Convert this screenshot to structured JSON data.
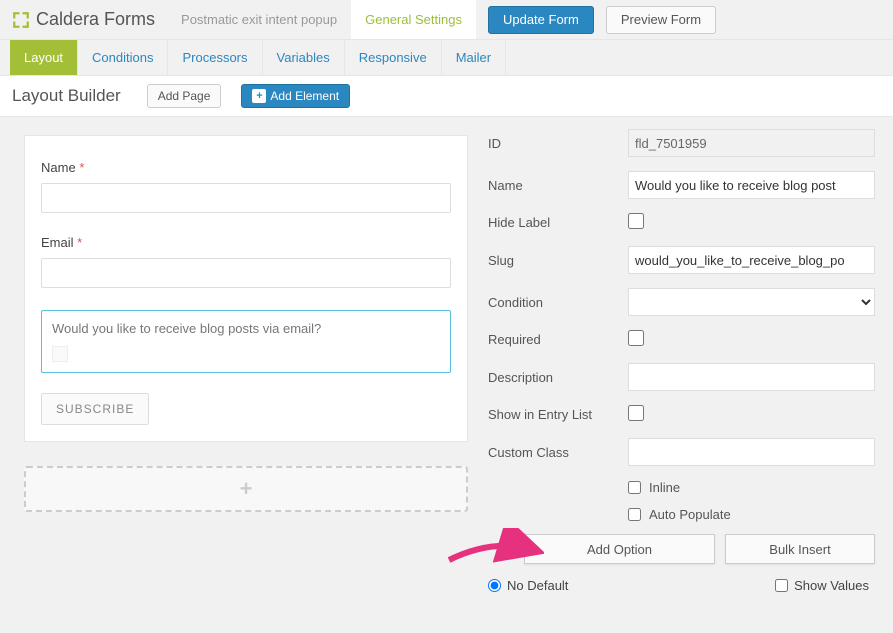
{
  "brand": {
    "title": "Caldera Forms"
  },
  "top": {
    "tab_inactive": "Postmatic exit intent popup",
    "tab_active": "General Settings",
    "update_btn": "Update Form",
    "preview_btn": "Preview Form"
  },
  "subtabs": [
    "Layout",
    "Conditions",
    "Processors",
    "Variables",
    "Responsive",
    "Mailer"
  ],
  "builder": {
    "title": "Layout Builder",
    "add_page": "Add Page",
    "add_element": "Add Element"
  },
  "preview": {
    "name_label": "Name",
    "email_label": "Email",
    "question": "Would you like to receive blog posts via email?",
    "subscribe": "SUBSCRIBE",
    "drop_plus": "+"
  },
  "settings": {
    "id_label": "ID",
    "id_value": "fld_7501959",
    "name_label": "Name",
    "name_value": "Would you like to receive blog post",
    "hide_label": "Hide Label",
    "slug_label": "Slug",
    "slug_value": "would_you_like_to_receive_blog_po",
    "condition_label": "Condition",
    "required_label": "Required",
    "description_label": "Description",
    "description_value": "",
    "show_entry_label": "Show in Entry List",
    "custom_class_label": "Custom Class",
    "custom_class_value": "",
    "inline_label": "Inline",
    "autopop_label": "Auto Populate",
    "add_option": "Add Option",
    "bulk_insert": "Bulk Insert",
    "no_default": "No Default",
    "show_values": "Show Values"
  }
}
